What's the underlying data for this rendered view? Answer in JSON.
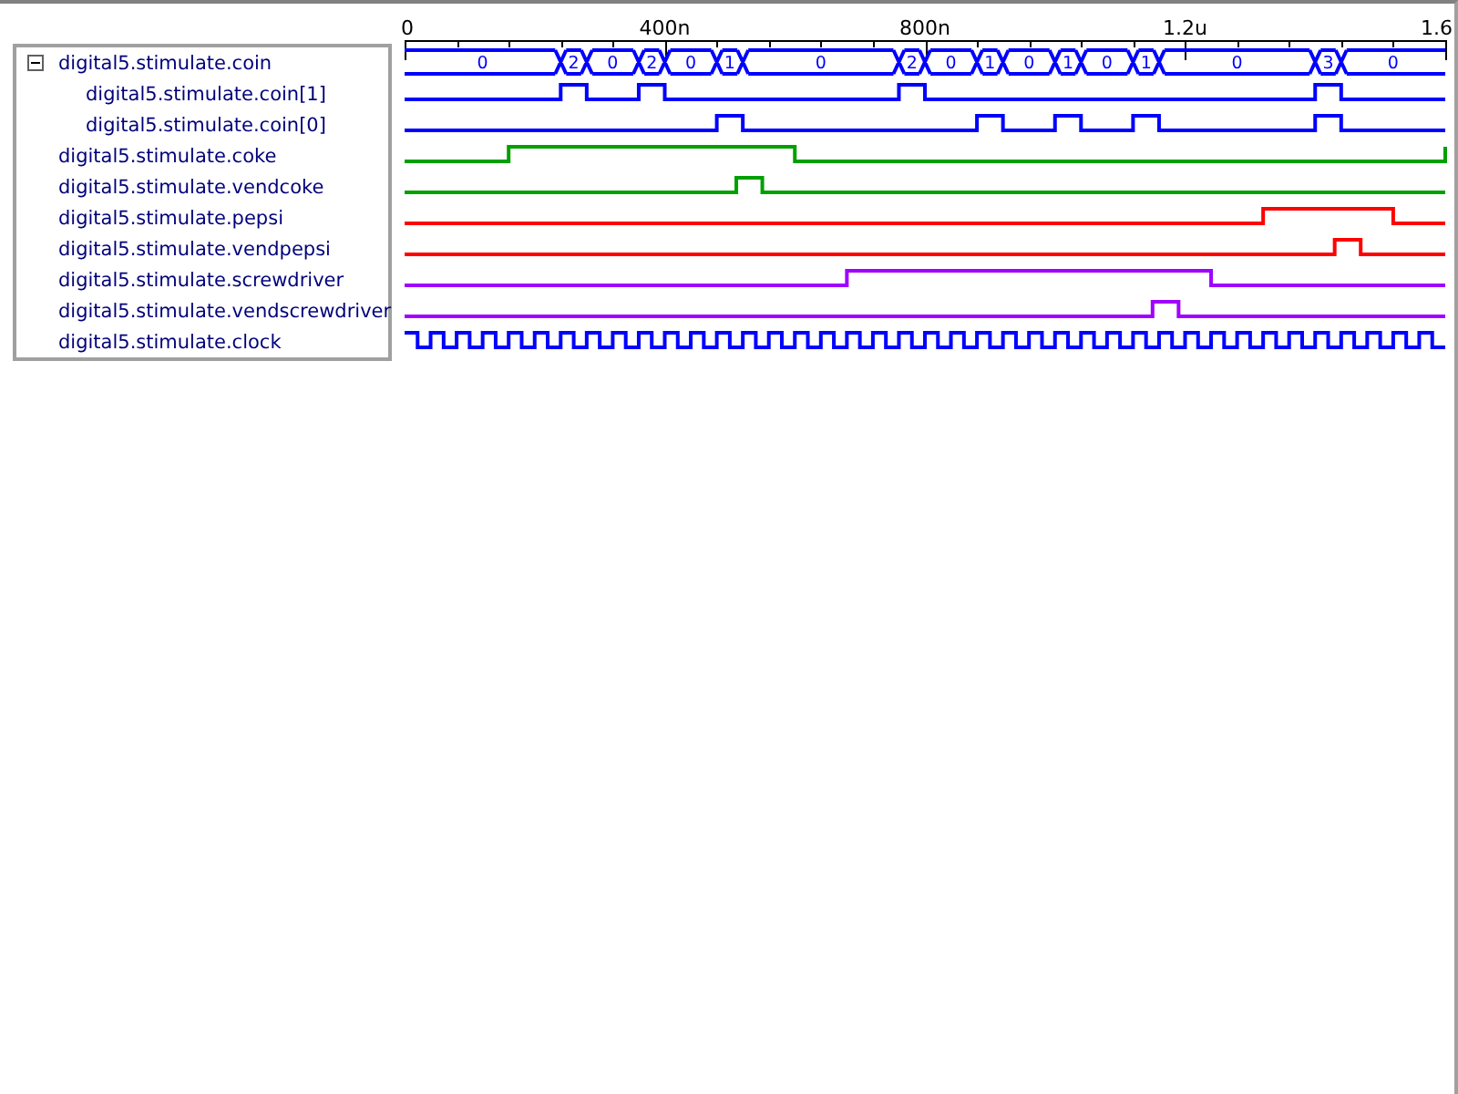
{
  "signals": [
    {
      "label": "digital5.stimulate.coin",
      "kind": "bus",
      "color": "#0000ff",
      "expanded": true,
      "values": [
        "0",
        "2",
        "0",
        "2",
        "0",
        "1",
        "0",
        "2",
        "0",
        "1",
        "0",
        "1",
        "0",
        "1",
        "0",
        "3",
        "0"
      ],
      "children": [
        {
          "label": "digital5.stimulate.coin[1]",
          "kind": "bit",
          "color": "#0000ff"
        },
        {
          "label": "digital5.stimulate.coin[0]",
          "kind": "bit",
          "color": "#0000ff"
        }
      ]
    },
    {
      "label": "digital5.stimulate.coke",
      "kind": "bit",
      "color": "#00a000"
    },
    {
      "label": "digital5.stimulate.vendcoke",
      "kind": "bit",
      "color": "#00a000"
    },
    {
      "label": "digital5.stimulate.pepsi",
      "kind": "bit",
      "color": "#ff0000"
    },
    {
      "label": "digital5.stimulate.vendpepsi",
      "kind": "bit",
      "color": "#ff0000"
    },
    {
      "label": "digital5.stimulate.screwdriver",
      "kind": "bit",
      "color": "#a000ff"
    },
    {
      "label": "digital5.stimulate.vendscrewdriver",
      "kind": "bit",
      "color": "#a000ff"
    },
    {
      "label": "digital5.stimulate.clock",
      "kind": "bit",
      "color": "#0000ff"
    }
  ],
  "time_axis": {
    "labels": [
      "0",
      "400n",
      "800n",
      "1.2u",
      "1.6"
    ]
  }
}
